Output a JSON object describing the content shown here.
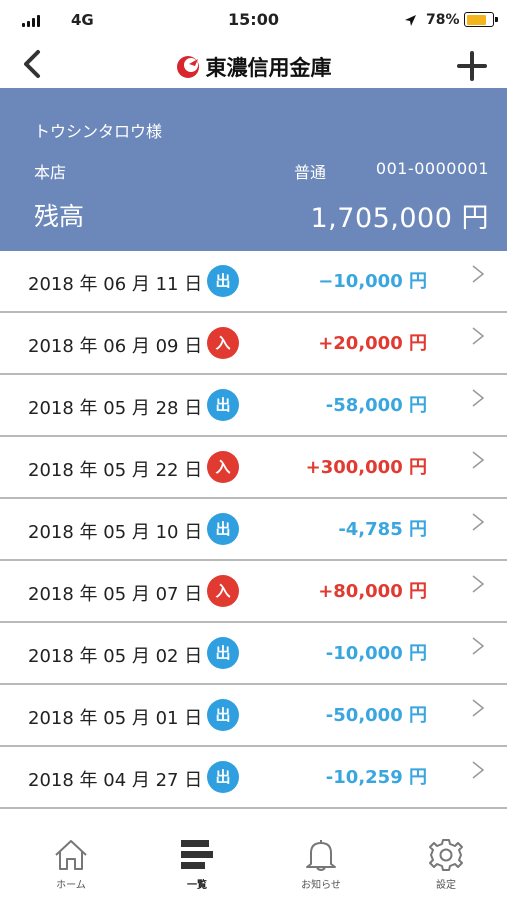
{
  "status_bar": {
    "carrier": "4G",
    "time": "15:00",
    "battery_percent": "78%",
    "battery_level": 0.78,
    "battery_color": "#f3b51b"
  },
  "nav": {
    "logo_text": "東濃信用金庫",
    "back_icon": "chevron-left-icon",
    "add_icon": "plus-icon"
  },
  "account": {
    "holder": "トウシンタロウ様",
    "branch": "本店",
    "type": "普通",
    "number": "001-0000001",
    "balance_label": "残高",
    "balance": "1,705,000 円",
    "panel_color": "#6c88ba"
  },
  "transactions": [
    {
      "date": "2018 年 06 月 11 日",
      "badge": "出",
      "kind": "out",
      "amount": "−10,000 円"
    },
    {
      "date": "2018 年 06 月 09 日",
      "badge": "入",
      "kind": "in",
      "amount": "+20,000 円"
    },
    {
      "date": "2018 年 05 月 28 日",
      "badge": "出",
      "kind": "out",
      "amount": "-58,000 円"
    },
    {
      "date": "2018 年 05 月 22 日",
      "badge": "入",
      "kind": "in",
      "amount": "+300,000 円"
    },
    {
      "date": "2018 年 05 月 10 日",
      "badge": "出",
      "kind": "out",
      "amount": "-4,785 円"
    },
    {
      "date": "2018 年 05 月 07 日",
      "badge": "入",
      "kind": "in",
      "amount": "+80,000 円"
    },
    {
      "date": "2018 年 05 月 02 日",
      "badge": "出",
      "kind": "out",
      "amount": "-10,000 円"
    },
    {
      "date": "2018 年 05 月 01 日",
      "badge": "出",
      "kind": "out",
      "amount": "-50,000 円"
    },
    {
      "date": "2018 年 04 月 27 日",
      "badge": "出",
      "kind": "out",
      "amount": "-10,259 円"
    }
  ],
  "colors": {
    "out": "#2f9fe0",
    "in": "#e03a31"
  },
  "tabs": [
    {
      "label": "ホーム",
      "icon": "home-icon"
    },
    {
      "label": "一覧",
      "icon": "list-icon",
      "active": true
    },
    {
      "label": "お知らせ",
      "icon": "bell-icon"
    },
    {
      "label": "設定",
      "icon": "gear-icon"
    }
  ]
}
